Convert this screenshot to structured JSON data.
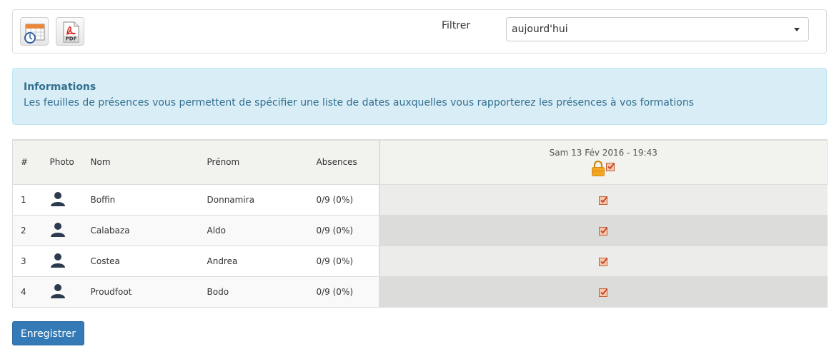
{
  "toolbar": {
    "calendar_icon": "calendar-clock-icon",
    "pdf_icon": "pdf-file-icon",
    "pdf_label": "PDF",
    "filter_label": "Filtrer",
    "filter_value": "aujourd'hui"
  },
  "info": {
    "title": "Informations",
    "text": "Les feuilles de présences vous permettent de spécifier une liste de dates auxquelles vous rapporterez les présences à vos formations"
  },
  "table": {
    "headers": {
      "num": "#",
      "photo": "Photo",
      "nom": "Nom",
      "prenom": "Prénom",
      "absences": "Absences",
      "session_date": "Sam 13 Fév 2016 - 19:43"
    },
    "rows": [
      {
        "num": "1",
        "nom": "Boffin",
        "prenom": "Donnamira",
        "absences": "0/9 (0%)",
        "present": true
      },
      {
        "num": "2",
        "nom": "Calabaza",
        "prenom": "Aldo",
        "absences": "0/9 (0%)",
        "present": true
      },
      {
        "num": "3",
        "nom": "Costea",
        "prenom": "Andrea",
        "absences": "0/9 (0%)",
        "present": true
      },
      {
        "num": "4",
        "nom": "Proudfoot",
        "prenom": "Bodo",
        "absences": "0/9 (0%)",
        "present": true
      }
    ]
  },
  "actions": {
    "save_label": "Enregistrer"
  },
  "colors": {
    "info_bg": "#d9edf7",
    "info_text": "#31708f",
    "primary": "#337ab7",
    "check": "#e07b39"
  }
}
